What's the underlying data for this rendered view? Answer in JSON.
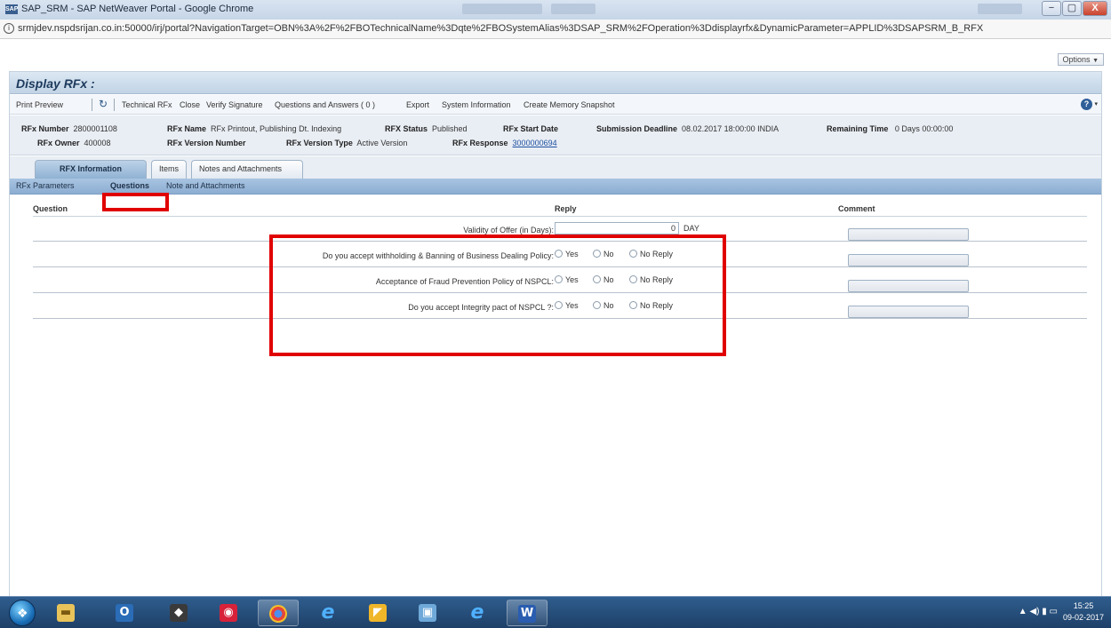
{
  "window": {
    "title": "SAP_SRM - SAP NetWeaver Portal - Google Chrome",
    "minimize": "−",
    "maximize": "▢",
    "close": "X"
  },
  "url": "srmjdev.nspdsrijan.co.in:50000/irj/portal?NavigationTarget=OBN%3A%2F%2FBOTechnicalName%3Dqte%2FBOSystemAlias%3DSAP_SRM%2FOperation%3Ddisplayrfx&DynamicParameter=APPLID%3DSAPSRM_B_RFX",
  "portal": {
    "options_label": "Options"
  },
  "page": {
    "title": "Display RFx :"
  },
  "toolbar": {
    "print_preview": "Print Preview",
    "technical_rfx": "Technical RFx",
    "close": "Close",
    "verify_signature": "Verify Signature",
    "questions_answers": "Questions and Answers ( 0 )",
    "export": "Export",
    "system_information": "System Information",
    "create_memory_snapshot": "Create Memory Snapshot"
  },
  "header_info": {
    "rfx_number_label": "RFx Number",
    "rfx_number": "2800001108",
    "rfx_owner_label": "RFx Owner",
    "rfx_owner": "400008",
    "rfx_name_label": "RFx Name",
    "rfx_name": "RFx Printout, Publishing Dt. Indexing",
    "rfx_version_number_label": "RFx Version Number",
    "rfx_status_label": "RFX Status",
    "rfx_status": "Published",
    "rfx_version_type_label": "RFx Version Type",
    "rfx_version_type": "Active Version",
    "rfx_start_date_label": "RFx Start Date",
    "rfx_response_label": "RFx Response",
    "rfx_response": "3000000694",
    "submission_deadline_label": "Submission Deadline",
    "submission_deadline": "08.02.2017 18:00:00 INDIA",
    "remaining_time_label": "Remaining Time",
    "remaining_time": "0 Days 00:00:00"
  },
  "tabs": [
    "RFX Information",
    "Items",
    "Notes and Attachments"
  ],
  "subtabs": [
    "RFx Parameters",
    "Questions",
    "Note and Attachments"
  ],
  "table": {
    "headers": {
      "question": "Question",
      "reply": "Reply",
      "comment": "Comment"
    },
    "rows": [
      {
        "question": "Validity of Offer (in Days):",
        "value": "0",
        "unit": "DAY"
      },
      {
        "question": "Do you accept withholding & Banning of Business Dealing Policy:",
        "options": [
          "Yes",
          "No",
          "No Reply"
        ]
      },
      {
        "question": "Acceptance of Fraud Prevention Policy of NSPCL:",
        "options": [
          "Yes",
          "No",
          "No Reply"
        ]
      },
      {
        "question": "Do you accept Integrity pact of NSPCL ?:",
        "options": [
          "Yes",
          "No",
          "No Reply"
        ]
      }
    ]
  },
  "taskbar": {
    "apps": [
      "folder-icon",
      "outlook-icon",
      "app-icon",
      "app-icon",
      "chrome-icon",
      "ie-icon",
      "app-icon",
      "app-icon",
      "ie-icon",
      "word-icon"
    ],
    "tray": "▲ ◀) ▮ ▭",
    "time": "15:25",
    "date": "09-02-2017"
  },
  "colors": {
    "highlight": "#e00000",
    "link": "#1c4fa0",
    "subtab_bar": "#8cadd2"
  }
}
